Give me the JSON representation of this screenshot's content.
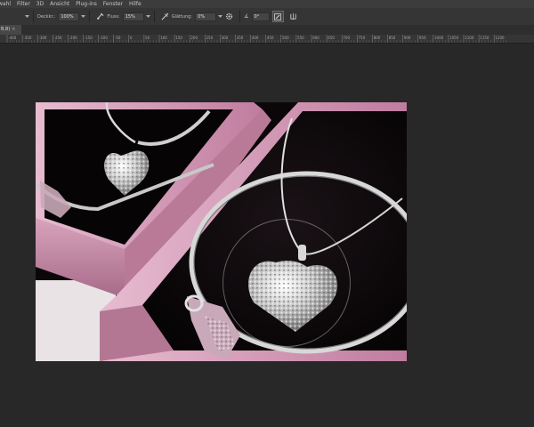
{
  "menubar": {
    "items": [
      "wahl",
      "Filter",
      "3D",
      "Ansicht",
      "Plug-ins",
      "Fenster",
      "Hilfe"
    ]
  },
  "options": {
    "brush_size_label": "Deckkr.:",
    "opacity_value": "100%",
    "flow_label": "Fluss:",
    "flow_value": "15%",
    "smoothing_label": "Glättung:",
    "smoothing_value": "0%",
    "angle_label": "∡",
    "angle_value": "0°"
  },
  "document_tab": {
    "title": "B,8)",
    "close_symbol": "×"
  },
  "ruler": {
    "labels": [
      "-400",
      "-350",
      "-300",
      "-250",
      "-200",
      "-150",
      "-100",
      "-50",
      "0",
      "50",
      "100",
      "150",
      "200",
      "250",
      "300",
      "350",
      "400",
      "450",
      "500",
      "550",
      "600",
      "650",
      "700",
      "750",
      "800",
      "850",
      "900",
      "950",
      "1000",
      "1050",
      "1100",
      "1150",
      "1200"
    ]
  },
  "colors": {
    "background": "#282828",
    "panel": "#353535",
    "box_pink": "#c88aa8",
    "velvet": "#0a0709"
  },
  "icons": {
    "brush": "brush-icon",
    "airbrush": "airbrush-icon",
    "gear": "gear-icon",
    "pressure": "pressure-icon",
    "symmetry": "symmetry-icon"
  }
}
